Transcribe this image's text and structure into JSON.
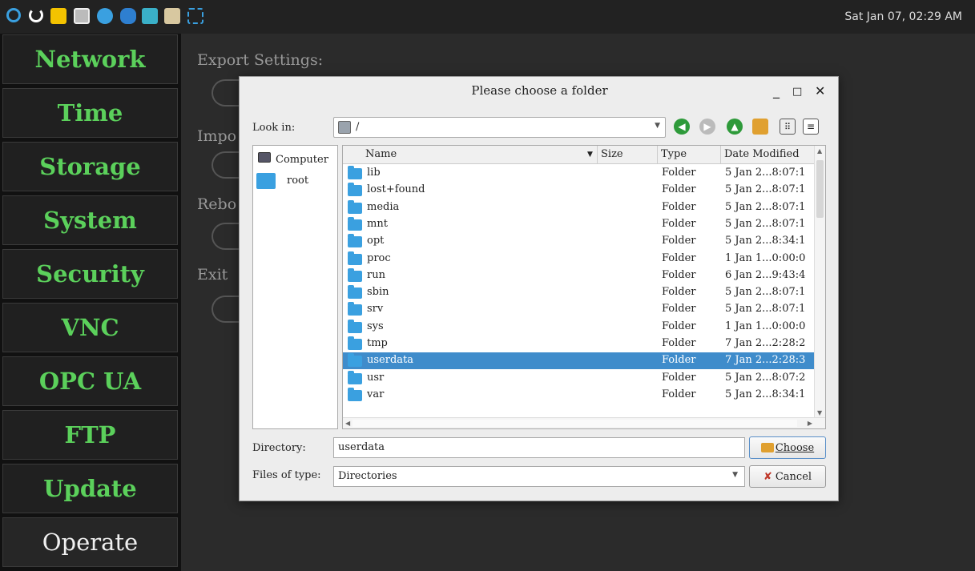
{
  "taskbar": {
    "clock": "Sat Jan 07, 02:29 AM",
    "icons": [
      "power-icon",
      "restart-icon",
      "nxp-icon",
      "screen-icon",
      "browser-icon",
      "settings-gear-icon",
      "magnifier-icon",
      "tightvnc-icon",
      "screenshot-icon"
    ],
    "colors": {
      "accent_blue": "#3aa0e0",
      "nav_green": "#5bd05b"
    }
  },
  "sidenav": {
    "items": [
      {
        "label": "Network"
      },
      {
        "label": "Time"
      },
      {
        "label": "Storage"
      },
      {
        "label": "System"
      },
      {
        "label": "Security"
      },
      {
        "label": "VNC"
      },
      {
        "label": "OPC UA"
      },
      {
        "label": "FTP"
      },
      {
        "label": "Update"
      },
      {
        "label": "Operate"
      }
    ]
  },
  "main": {
    "sections": [
      "Export Settings:",
      "Impo",
      "Rebo",
      "Exit"
    ]
  },
  "dialog": {
    "title": "Please choose a folder",
    "look_in_label": "Look in:",
    "look_in_value": "/",
    "places": [
      {
        "label": "Computer"
      },
      {
        "label": "root"
      }
    ],
    "columns": {
      "name": "Name",
      "size": "Size",
      "type": "Type",
      "date": "Date Modified"
    },
    "files": [
      {
        "name": "lib",
        "type": "Folder",
        "date": "5 Jan 2...8:07:1"
      },
      {
        "name": "lost+found",
        "type": "Folder",
        "date": "5 Jan 2...8:07:1"
      },
      {
        "name": "media",
        "type": "Folder",
        "date": "5 Jan 2...8:07:1"
      },
      {
        "name": "mnt",
        "type": "Folder",
        "date": "5 Jan 2...8:07:1"
      },
      {
        "name": "opt",
        "type": "Folder",
        "date": "5 Jan 2...8:34:1"
      },
      {
        "name": "proc",
        "type": "Folder",
        "date": "1 Jan 1...0:00:0"
      },
      {
        "name": "run",
        "type": "Folder",
        "date": "6 Jan 2...9:43:4"
      },
      {
        "name": "sbin",
        "type": "Folder",
        "date": "5 Jan 2...8:07:1"
      },
      {
        "name": "srv",
        "type": "Folder",
        "date": "5 Jan 2...8:07:1"
      },
      {
        "name": "sys",
        "type": "Folder",
        "date": "1 Jan 1...0:00:0"
      },
      {
        "name": "tmp",
        "type": "Folder",
        "date": "7 Jan 2...2:28:2"
      },
      {
        "name": "userdata",
        "type": "Folder",
        "date": "7 Jan 2...2:28:3",
        "selected": true
      },
      {
        "name": "usr",
        "type": "Folder",
        "date": "5 Jan 2...8:07:2"
      },
      {
        "name": "var",
        "type": "Folder",
        "date": "5 Jan 2...8:34:1"
      }
    ],
    "directory_label": "Directory:",
    "directory_value": "userdata",
    "files_of_type_label": "Files of type:",
    "files_of_type_value": "Directories",
    "choose_label": "Choose",
    "cancel_label": "Cancel"
  }
}
